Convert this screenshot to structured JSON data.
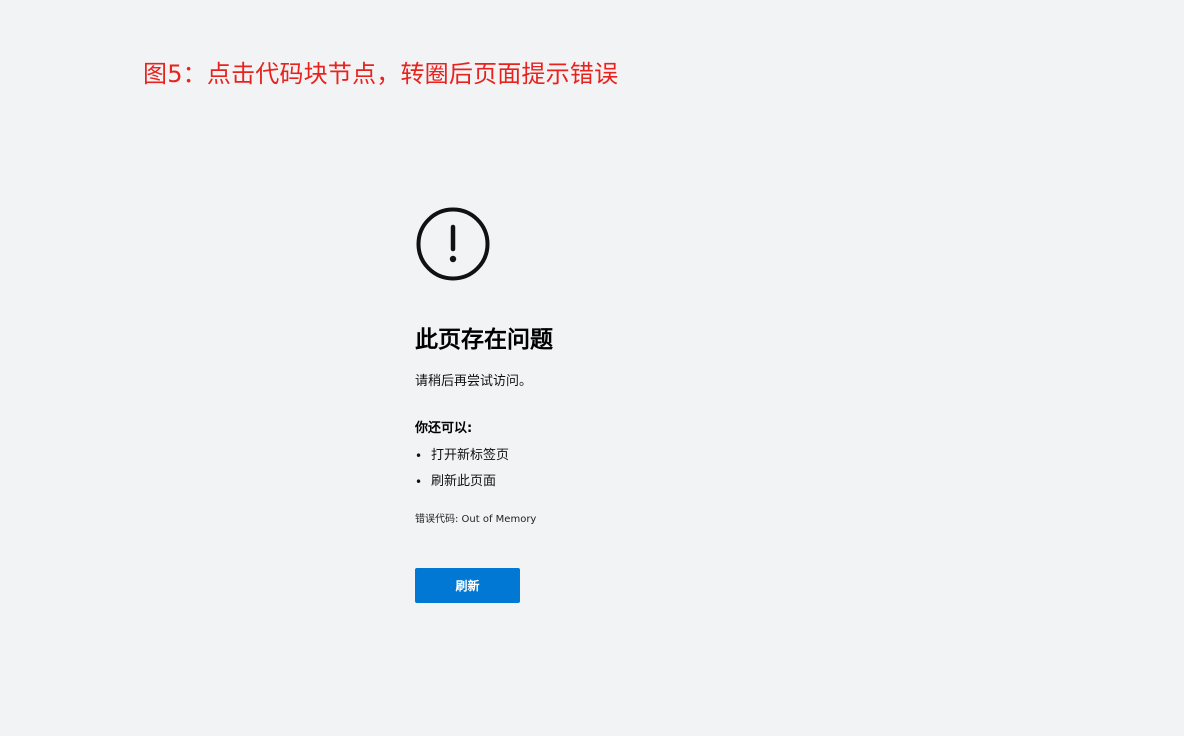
{
  "caption": "图5：点击代码块节点，转圈后页面提示错误",
  "error_page": {
    "icon": "exclamation-circle-icon",
    "title": "此页存在问题",
    "subtitle": "请稍后再尝试访问。",
    "suggestions_heading": "你还可以:",
    "bullet": "•",
    "suggestions": [
      "打开新标签页",
      "刷新此页面"
    ],
    "error_code": "错误代码: Out of Memory",
    "refresh_label": "刷新"
  },
  "colors": {
    "caption": "#e8231e",
    "background": "#f2f3f5",
    "button": "#0078d4",
    "button_text": "#ffffff",
    "icon": "#111111"
  }
}
